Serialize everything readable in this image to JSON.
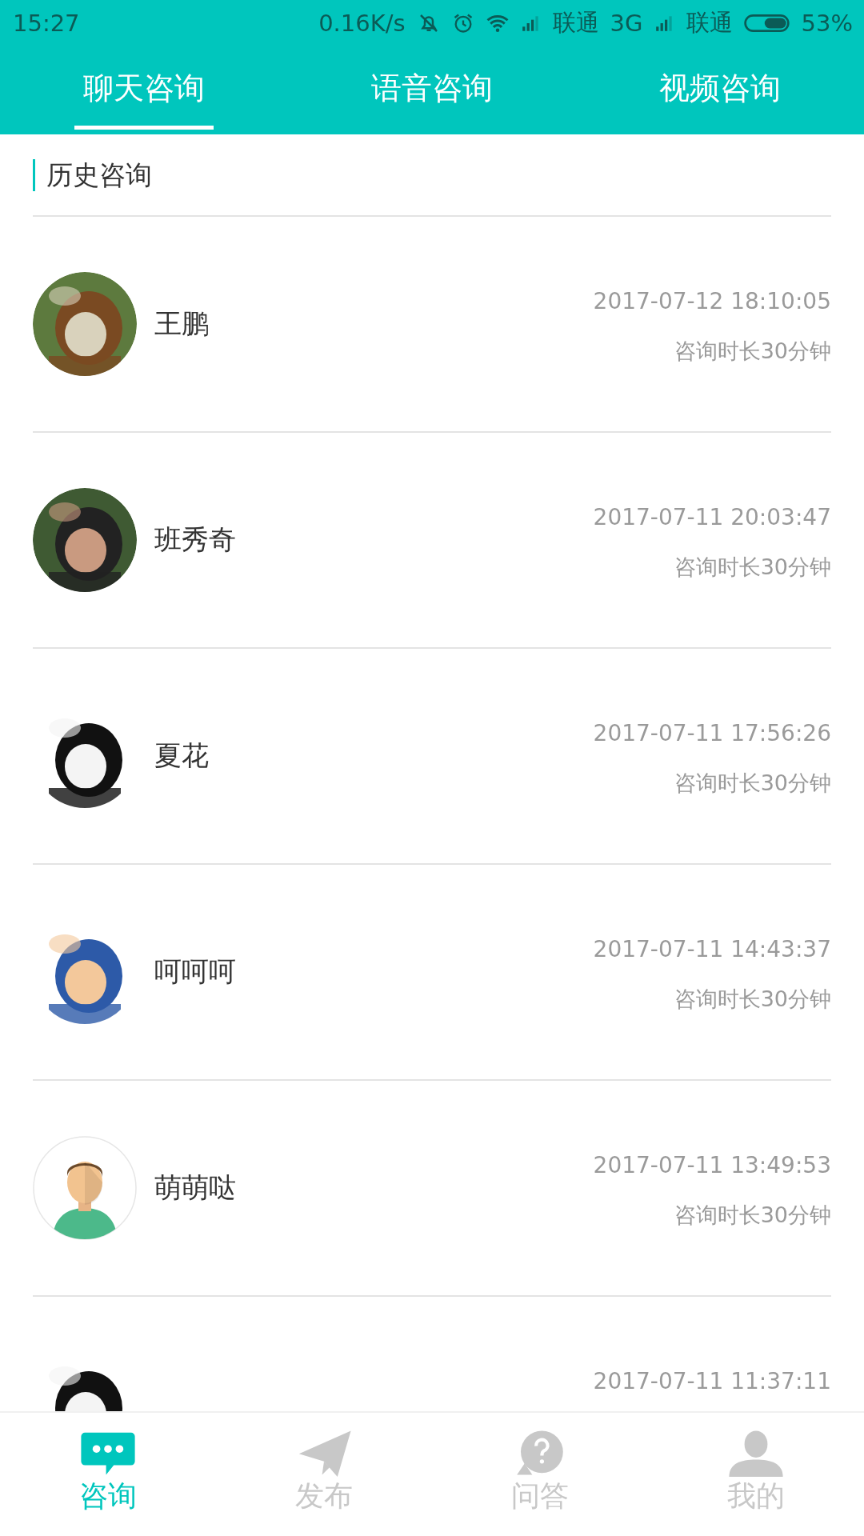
{
  "status_bar": {
    "time": "15:27",
    "speed": "0.16K/s",
    "carrier_1": "联通",
    "network": "3G",
    "carrier_2": "联通",
    "battery": "53%"
  },
  "tabs": [
    {
      "label": "聊天咨询",
      "selected": true
    },
    {
      "label": "语音咨询",
      "selected": false
    },
    {
      "label": "视频咨询",
      "selected": false
    }
  ],
  "section_title": "历史咨询",
  "consultations": [
    {
      "name": "王鹏",
      "time": "2017-07-12 18:10:05",
      "duration": "咨询时长30分钟"
    },
    {
      "name": "班秀奇",
      "time": "2017-07-11 20:03:47",
      "duration": "咨询时长30分钟"
    },
    {
      "name": "夏花",
      "time": "2017-07-11 17:56:26",
      "duration": "咨询时长30分钟"
    },
    {
      "name": "呵呵呵",
      "time": "2017-07-11 14:43:37",
      "duration": "咨询时长30分钟"
    },
    {
      "avatar": {
        "kind": "default"
      },
      "name": "萌萌哒",
      "time": "2017-07-11 13:49:53",
      "duration": "咨询时长30分钟"
    },
    {
      "time": "2017-07-11 11:37:11"
    }
  ],
  "bottom_nav": [
    {
      "kind": "chat",
      "label": "咨询",
      "selected": true
    },
    {
      "kind": "send",
      "label": "发布",
      "selected": false
    },
    {
      "kind": "question",
      "label": "问答",
      "selected": false
    },
    {
      "kind": "profile",
      "label": "我的",
      "selected": false
    }
  ]
}
